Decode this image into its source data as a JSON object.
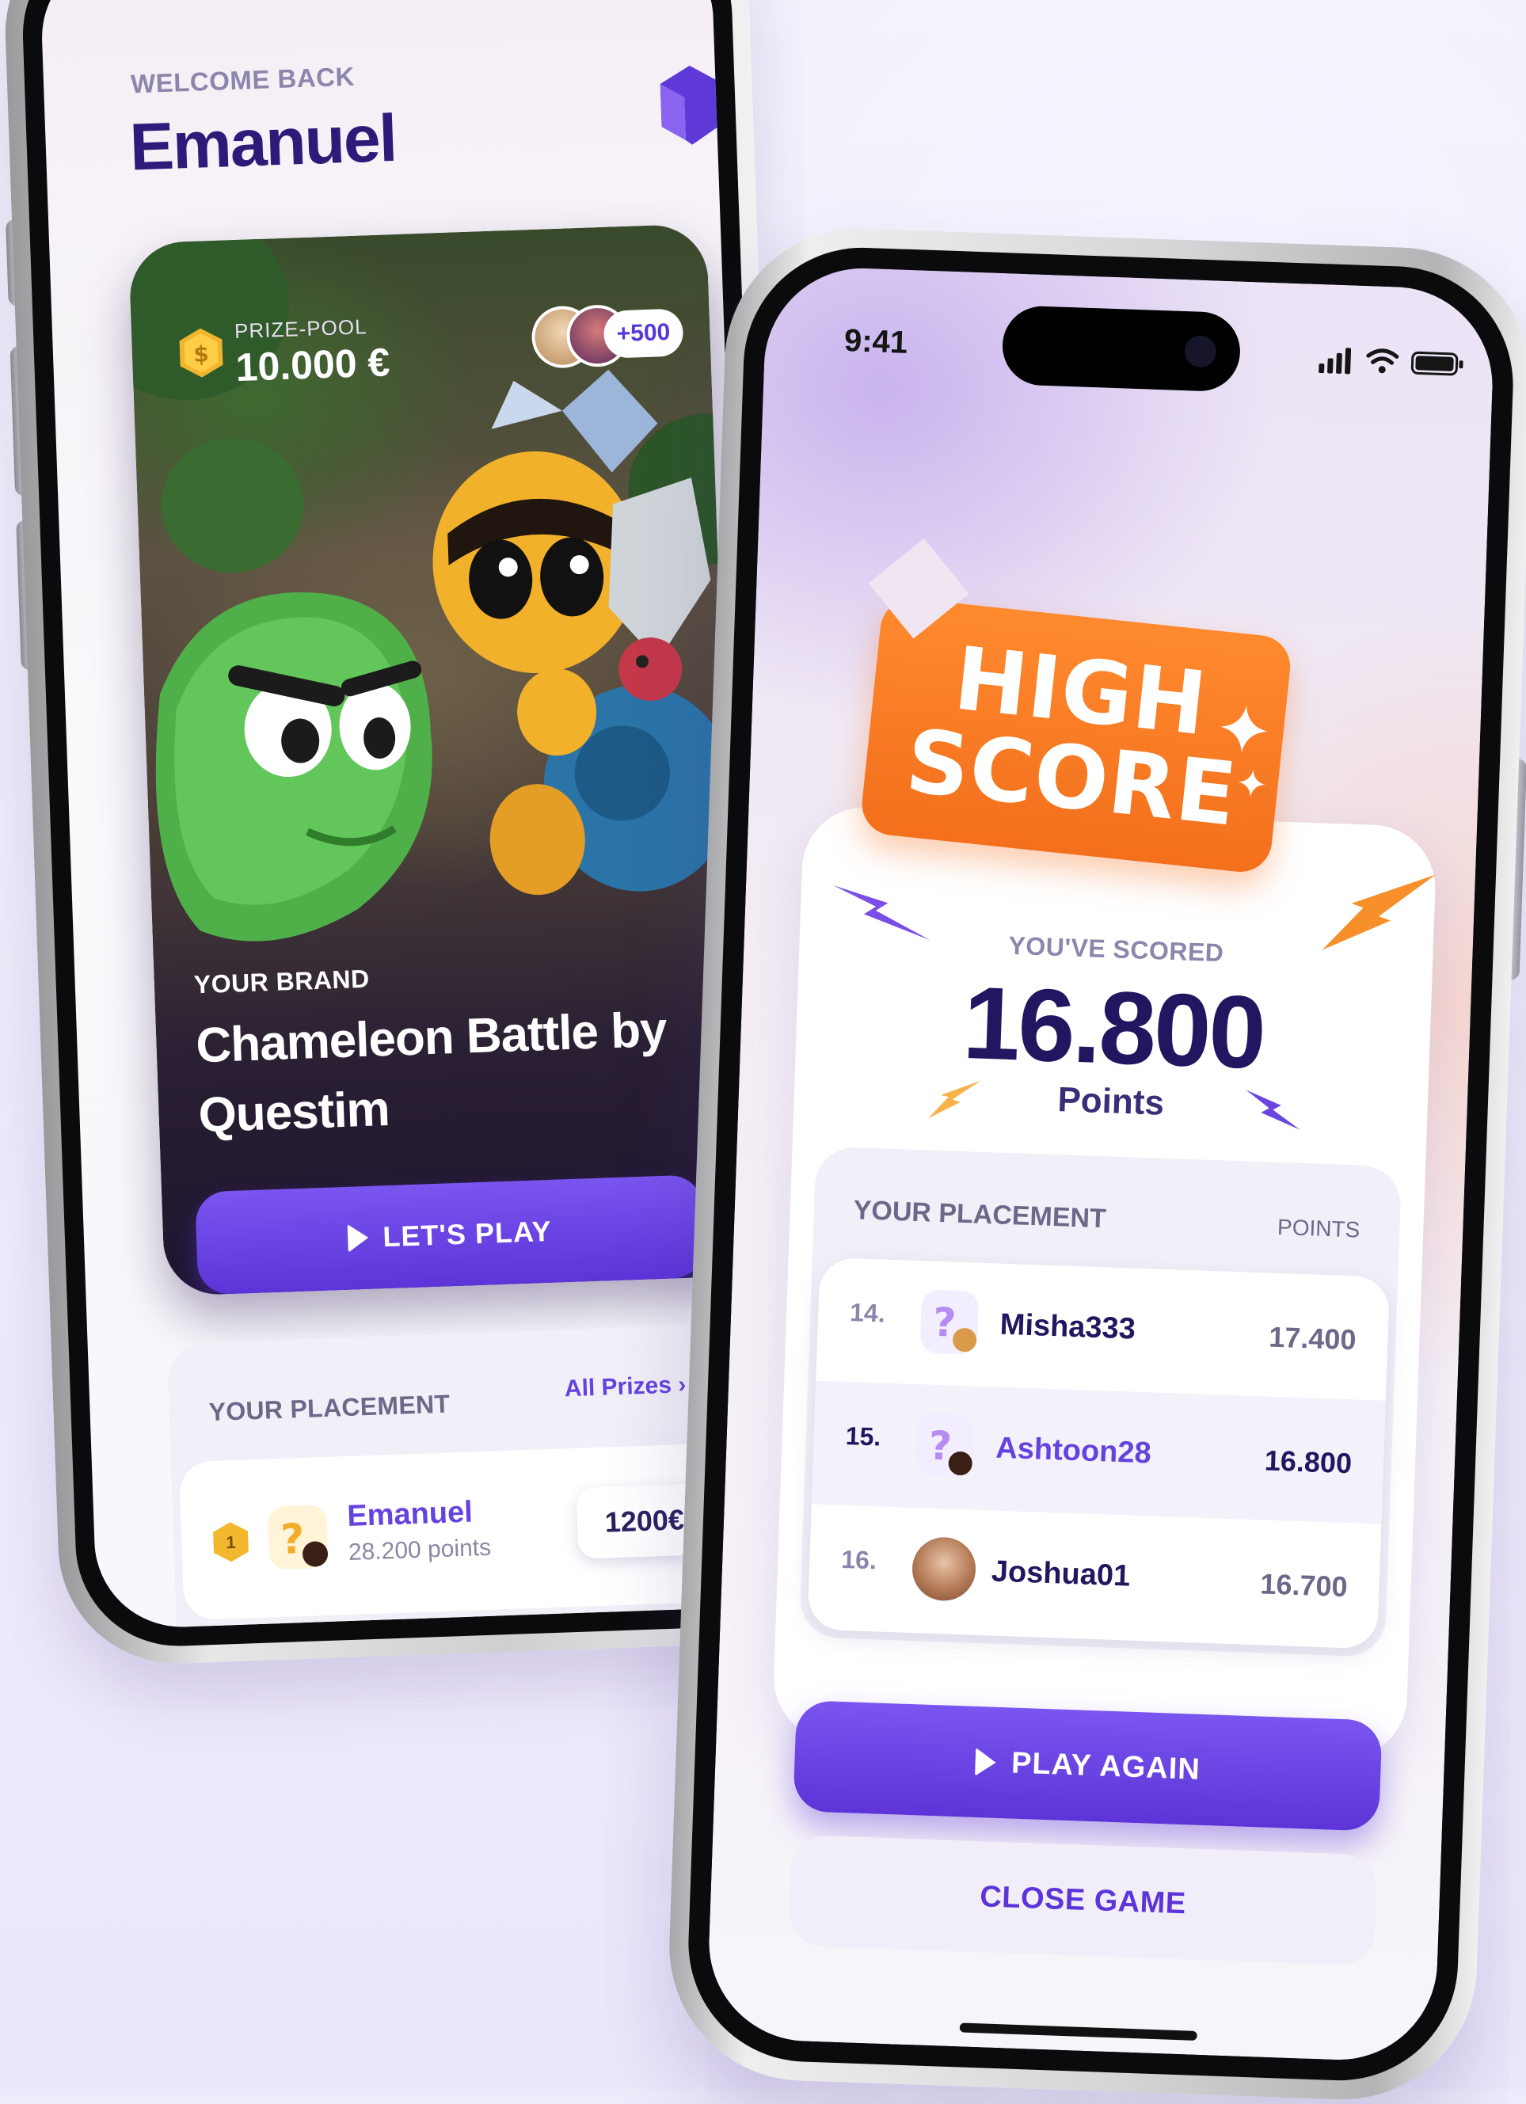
{
  "left_screen": {
    "welcome": "WELCOME BACK",
    "username": "Emanuel",
    "game_card": {
      "prize_pool_label": "PRIZE-POOL",
      "prize_pool_value": "10.000 €",
      "players_extra": "+500",
      "brand": "YOUR BRAND",
      "title": "Chameleon Battle by Questim",
      "play_label": "LET'S PLAY"
    },
    "placement": {
      "label": "YOUR PLACEMENT",
      "all_prizes": "All Prizes",
      "rows": [
        {
          "rank": "1",
          "name": "Emanuel",
          "points": "28.200 points",
          "prize": "1200€"
        }
      ]
    }
  },
  "right_screen": {
    "status_time": "9:41",
    "badge_line1": "HIGH",
    "badge_line2": "SCORE",
    "you_scored": "YOU'VE SCORED",
    "score": "16.800",
    "score_unit": "Points",
    "placement": {
      "label": "YOUR PLACEMENT",
      "points_header": "POINTS",
      "rows": [
        {
          "rank": "14.",
          "name": "Misha333",
          "score": "17.400",
          "highlight": false
        },
        {
          "rank": "15.",
          "name": "Ashtoon28",
          "score": "16.800",
          "highlight": true
        },
        {
          "rank": "16.",
          "name": "Joshua01",
          "score": "16.700",
          "highlight": false
        }
      ]
    },
    "play_again_label": "PLAY AGAIN",
    "close_game_label": "CLOSE GAME"
  },
  "colors": {
    "brand_purple": "#6642df",
    "deep_navy": "#231660",
    "badge_orange": "#f36f1c"
  }
}
